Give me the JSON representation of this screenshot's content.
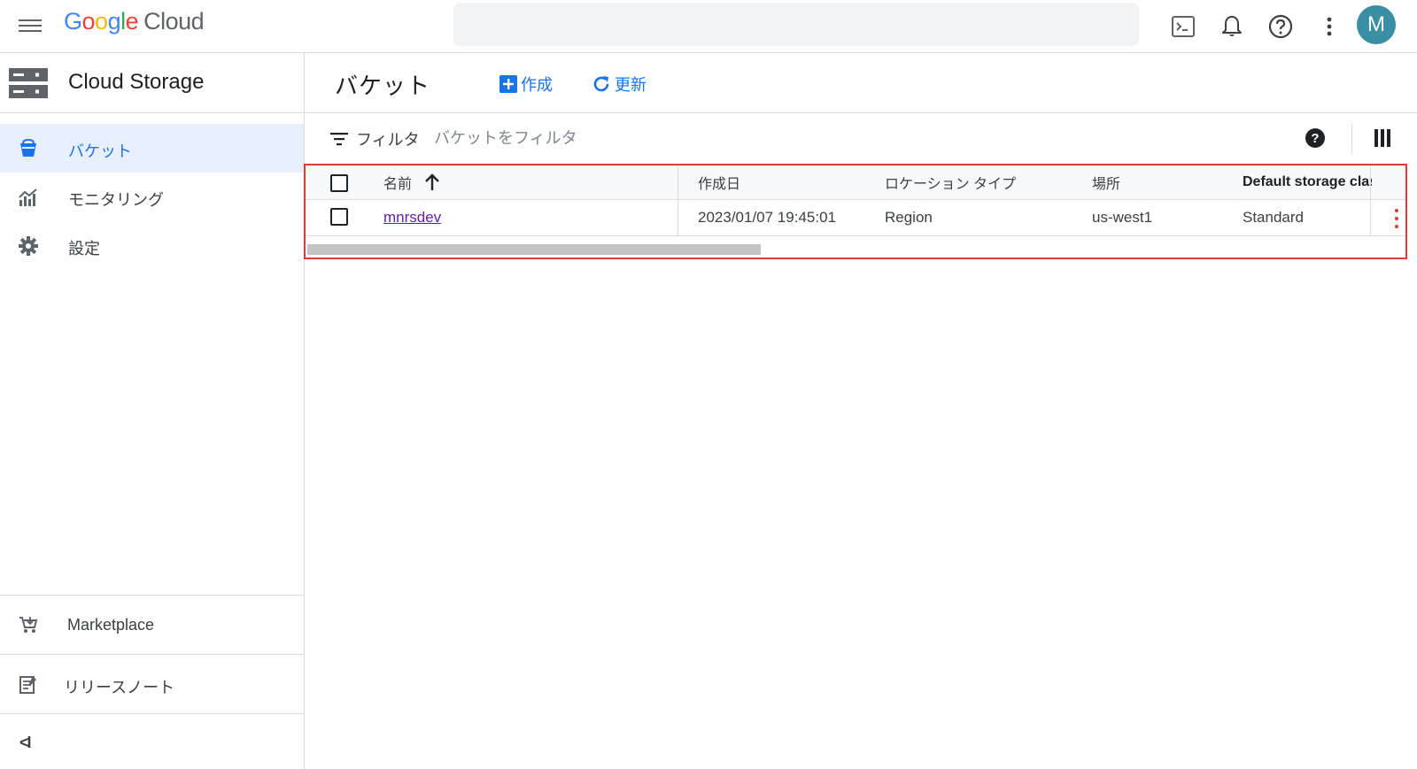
{
  "topbar": {
    "logo": {
      "g1": "G",
      "o1": "o",
      "o2": "o",
      "g2": "g",
      "l": "l",
      "e": "e",
      "cloud": "Cloud"
    },
    "search_placeholder": "",
    "avatar_initial": "M"
  },
  "sidebar": {
    "product_title": "Cloud Storage",
    "items": [
      {
        "label": "バケット",
        "icon": "bucket-icon",
        "active": true
      },
      {
        "label": "モニタリング",
        "icon": "monitoring-chart-icon",
        "active": false
      },
      {
        "label": "設定",
        "icon": "gear-icon",
        "active": false
      }
    ],
    "bottom_items": [
      {
        "label": "Marketplace",
        "icon": "marketplace-cart-icon"
      },
      {
        "label": "リリースノート",
        "icon": "release-notes-icon"
      }
    ],
    "collapse_glyph": "<I"
  },
  "main": {
    "page_title": "バケット",
    "create_label": "作成",
    "refresh_label": "更新",
    "filter_label": "フィルタ",
    "filter_placeholder": "バケットをフィルタ",
    "help_glyph": "?"
  },
  "table": {
    "columns": [
      {
        "label": "名前",
        "sort": "ascending"
      },
      {
        "label": "作成日"
      },
      {
        "label": "ロケーション タイプ"
      },
      {
        "label": "場所"
      },
      {
        "label": "Default storage clas"
      }
    ],
    "rows": [
      {
        "name": "mnrsdev",
        "created": "2023/01/07 19:45:01",
        "location_type": "Region",
        "location": "us-west1",
        "storage_class": "Standard"
      }
    ]
  },
  "colors": {
    "accent": "#1a73e8",
    "highlight_border": "#e53935",
    "link_visited": "#681da8",
    "avatar_bg": "#3a8fa5"
  }
}
